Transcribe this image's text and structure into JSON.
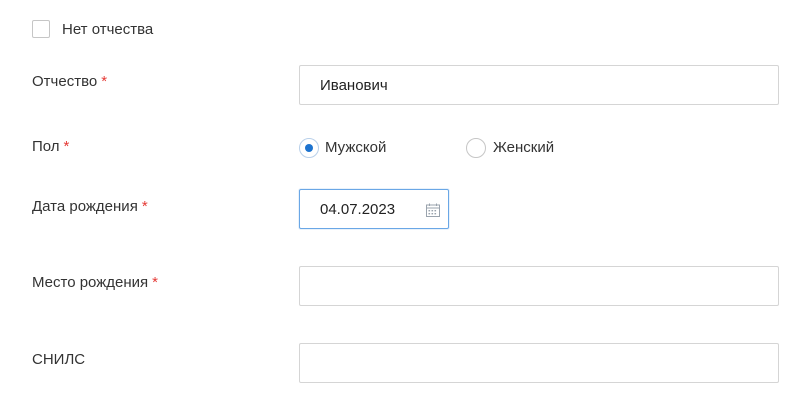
{
  "no_patronymic": {
    "label": "Нет отчества",
    "checked": false
  },
  "patronymic": {
    "label": "Отчество",
    "required_mark": "*",
    "value": "Иванович"
  },
  "gender": {
    "label": "Пол",
    "required_mark": "*",
    "options": [
      {
        "label": "Мужской",
        "selected": true
      },
      {
        "label": "Женский",
        "selected": false
      }
    ]
  },
  "birth_date": {
    "label": "Дата рождения",
    "required_mark": "*",
    "value": "04.07.2023",
    "icon": "calendar-icon"
  },
  "birth_place": {
    "label": "Место рождения",
    "required_mark": "*",
    "value": ""
  },
  "snils": {
    "label": "СНИЛС",
    "value": ""
  },
  "colors": {
    "accent": "#1d73cf",
    "required": "#e53935",
    "focus_border": "#6aa7e6"
  }
}
